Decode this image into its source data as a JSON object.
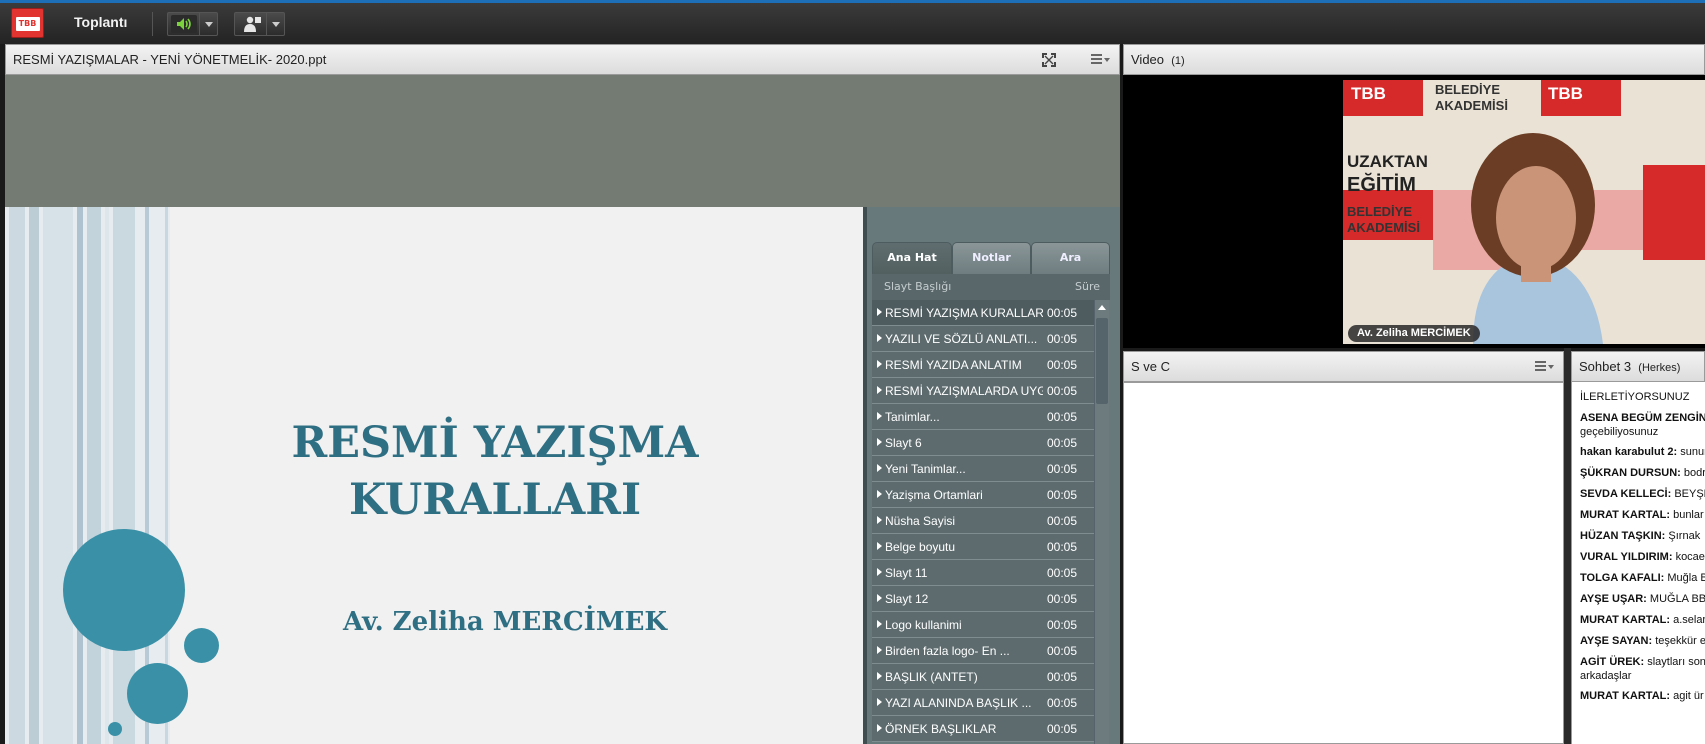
{
  "topbar": {
    "logo_text": "TBB",
    "meeting_menu": "Toplantı"
  },
  "share_pod": {
    "title": "RESMİ YAZIŞMALAR  - YENİ YÖNETMELİK-   2020.ppt"
  },
  "slide": {
    "title_line1": "RESMİ YAZIŞMA",
    "title_line2": "KURALLARI",
    "author": "Av. Zeliha MERCİMEK"
  },
  "outline": {
    "tabs": [
      "Ana Hat",
      "Notlar",
      "Ara"
    ],
    "col_title": "Slayt Başlığı",
    "col_duration": "Süre",
    "items": [
      {
        "title": "RESMİ YAZIŞMA KURALLAR",
        "duration": "00:05"
      },
      {
        "title": "YAZILI VE SÖZLÜ ANLATI...",
        "duration": "00:05"
      },
      {
        "title": "RESMİ YAZIDA ANLATIM",
        "duration": "00:05"
      },
      {
        "title": "RESMİ YAZIŞMALARDA UYG",
        "duration": "00:05"
      },
      {
        "title": "Tanimlar...",
        "duration": "00:05"
      },
      {
        "title": "Slayt 6",
        "duration": "00:05"
      },
      {
        "title": "Yeni Tanimlar...",
        "duration": "00:05"
      },
      {
        "title": "Yazişma Ortamlari",
        "duration": "00:05"
      },
      {
        "title": "Nüsha Sayisi",
        "duration": "00:05"
      },
      {
        "title": "Belge boyutu",
        "duration": "00:05"
      },
      {
        "title": "Slayt 11",
        "duration": "00:05"
      },
      {
        "title": "Slayt 12",
        "duration": "00:05"
      },
      {
        "title": "Logo kullanimi",
        "duration": "00:05"
      },
      {
        "title": "Birden fazla logo- En ...",
        "duration": "00:05"
      },
      {
        "title": "BAŞLIK (ANTET)",
        "duration": "00:05"
      },
      {
        "title": "YAZI ALANINDA  BAŞLIK ...",
        "duration": "00:05"
      },
      {
        "title": "ÖRNEK BAŞLIKLAR",
        "duration": "00:05"
      }
    ]
  },
  "video_pod": {
    "title": "Video",
    "count": "(1)",
    "participant_name": "Av. Zeliha MERCİMEK",
    "backdrop_text": {
      "brand": "TBB",
      "line1": "BELEDİYE",
      "line2": "AKADEMİSİ",
      "line3": "UZAKTAN",
      "line4": "EĞİTİM"
    }
  },
  "qa_pod": {
    "title": "S ve C"
  },
  "chat_pod": {
    "title": "Sohbet 3",
    "scope": "(Herkes)",
    "messages": [
      {
        "sender": "",
        "text": "İLERLETİYORSUNUZ"
      },
      {
        "sender": "ASENA BEGÜM ZENGİN:",
        "text": "geçebiliyosunuz"
      },
      {
        "sender": "hakan karabulut 2:",
        "text": "sunur"
      },
      {
        "sender": "ŞÜKRAN DURSUN:",
        "text": "bodr"
      },
      {
        "sender": "SEVDA KELLECİ:",
        "text": "BEYŞEH"
      },
      {
        "sender": "MURAT KARTAL:",
        "text": "bunlar"
      },
      {
        "sender": "HÜZAN TAŞKIN:",
        "text": "Şırnak"
      },
      {
        "sender": "VURAL YILDIRIM:",
        "text": "kocae"
      },
      {
        "sender": "TOLGA KAFALI:",
        "text": "Muğla B"
      },
      {
        "sender": "AYŞE UŞAR:",
        "text": "MUĞLA BB"
      },
      {
        "sender": "MURAT KARTAL:",
        "text": "a.selar"
      },
      {
        "sender": "AYŞE SAYAN:",
        "text": "teşekkür e"
      },
      {
        "sender": "AGİT ÜREK:",
        "text": "slaytları son",
        "text2": "arkadaşlar"
      },
      {
        "sender": "MURAT KARTAL:",
        "text": "agit ür"
      }
    ]
  }
}
